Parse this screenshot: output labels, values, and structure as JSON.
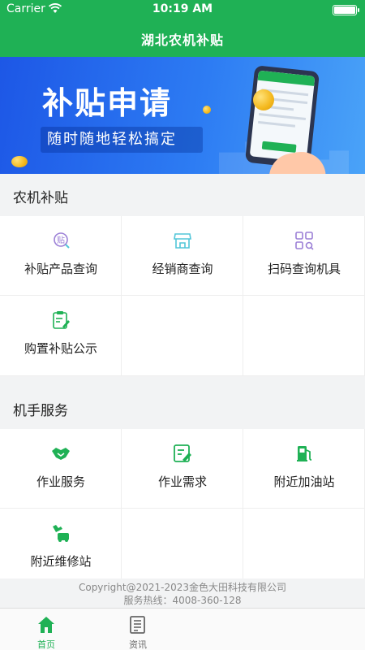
{
  "status_bar": {
    "carrier": "Carrier",
    "time": "10:19 AM"
  },
  "nav": {
    "title": "湖北农机补贴"
  },
  "banner": {
    "title": "补贴申请",
    "subtitle": "随时随地轻松搞定"
  },
  "sections": [
    {
      "title": "农机补贴",
      "items": [
        {
          "label": "补贴产品查询",
          "icon": "subsidy-search-icon"
        },
        {
          "label": "经销商查询",
          "icon": "store-icon"
        },
        {
          "label": "扫码查询机具",
          "icon": "scan-grid-icon"
        },
        {
          "label": "购置补贴公示",
          "icon": "clipboard-edit-icon"
        }
      ]
    },
    {
      "title": "机手服务",
      "items": [
        {
          "label": "作业服务",
          "icon": "handshake-icon"
        },
        {
          "label": "作业需求",
          "icon": "edit-form-icon"
        },
        {
          "label": "附近加油站",
          "icon": "fuel-pump-icon"
        },
        {
          "label": "附近维修站",
          "icon": "repair-wrench-icon"
        }
      ]
    }
  ],
  "footer": {
    "copyright": "Copyright@2021-2023金色大田科技有限公司",
    "hotline": "服务热线：4008-360-128"
  },
  "tabs": [
    {
      "label": "首页",
      "icon": "home-icon",
      "active": true
    },
    {
      "label": "资讯",
      "icon": "news-icon",
      "active": false
    }
  ],
  "colors": {
    "brand_green": "#1fb155",
    "banner_blue": "#2d7cf3",
    "icon_purple": "#9b7fd6",
    "icon_cyan": "#52c6d8"
  }
}
